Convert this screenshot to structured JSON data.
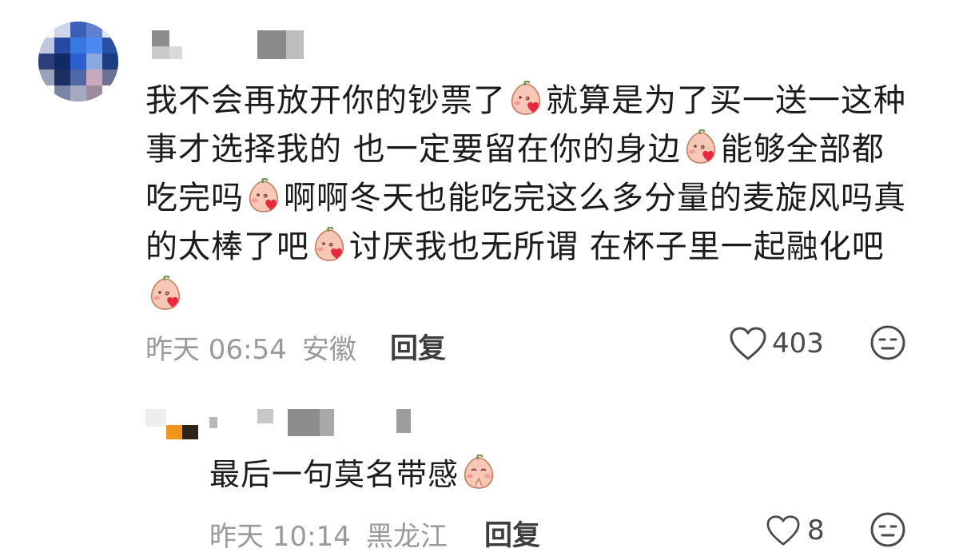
{
  "comment": {
    "segments": [
      {
        "type": "text",
        "value": "我不会再放开你的钞票了"
      },
      {
        "type": "emoji",
        "name": "peach-blush-emoji"
      },
      {
        "type": "text",
        "value": "就算是为了买一送一这种事才选择我的 也一定要留在你的身边"
      },
      {
        "type": "emoji",
        "name": "peach-blush-emoji"
      },
      {
        "type": "text",
        "value": "能够全部都吃完吗"
      },
      {
        "type": "emoji",
        "name": "peach-blush-emoji"
      },
      {
        "type": "text",
        "value": "啊啊冬天也能吃完这么多分量的麦旋风吗真的太棒了吧"
      },
      {
        "type": "emoji",
        "name": "peach-blush-emoji"
      },
      {
        "type": "text",
        "value": "讨厌我也无所谓 在杯子里一起融化吧"
      },
      {
        "type": "emoji",
        "name": "peach-blush-emoji"
      }
    ],
    "time": "昨天 06:54",
    "location": "安徽",
    "reply_label": "回复",
    "like_count": "403"
  },
  "reply": {
    "text": "最后一句莫名带感",
    "emoji": "peach-praying-emoji",
    "time": "昨天 10:14",
    "location": "黑龙江",
    "reply_label": "回复",
    "like_count": "8"
  },
  "colors": {
    "text": "#1b1b1b",
    "meta": "#9a9a9a",
    "reply_button": "#3e3e3e",
    "emoji_peach": "#f7c8b6",
    "emoji_heart": "#e8283c"
  }
}
